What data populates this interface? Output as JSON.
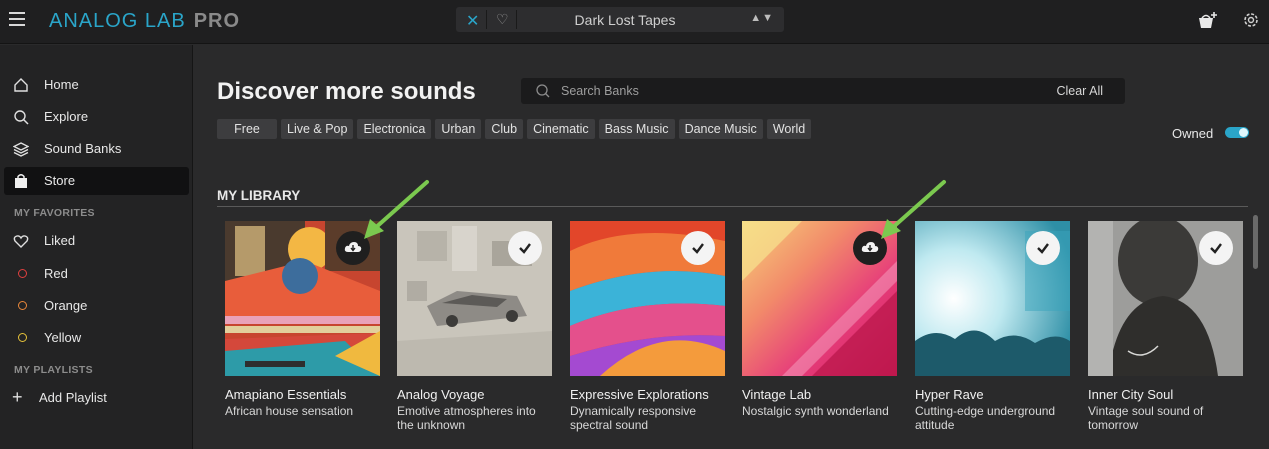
{
  "app": {
    "logo_main": "ANALOG LAB",
    "logo_edition": "PRO"
  },
  "preset_bar": {
    "preset_name": "Dark Lost Tapes",
    "nav_arrows": "▲▼"
  },
  "sidebar": {
    "nav": [
      {
        "label": "Home",
        "icon": "home-icon"
      },
      {
        "label": "Explore",
        "icon": "search-icon"
      },
      {
        "label": "Sound Banks",
        "icon": "layers-icon"
      },
      {
        "label": "Store",
        "icon": "shopping-bag-icon",
        "active": true
      }
    ],
    "favorites_header": "MY FAVORITES",
    "favorites": [
      {
        "label": "Liked",
        "icon": "heart-icon"
      },
      {
        "label": "Red",
        "color": "#e0403f"
      },
      {
        "label": "Orange",
        "color": "#e9873a"
      },
      {
        "label": "Yellow",
        "color": "#e6c23a"
      }
    ],
    "playlists_header": "MY PLAYLISTS",
    "add_playlist": "Add Playlist"
  },
  "main": {
    "title": "Discover more sounds",
    "search_placeholder": "Search Banks",
    "clear_all": "Clear All",
    "tags": [
      "Free",
      "Live & Pop",
      "Electronica",
      "Urban",
      "Club",
      "Cinematic",
      "Bass Music",
      "Dance Music",
      "World"
    ],
    "owned_label": "Owned",
    "owned_toggle_on": true,
    "library_header": "MY LIBRARY",
    "banks": [
      {
        "title": "Amapiano Essentials",
        "desc": "African house sensation",
        "status": "download"
      },
      {
        "title": "Analog Voyage",
        "desc": "Emotive atmospheres into the unknown",
        "status": "owned"
      },
      {
        "title": "Expressive Explorations",
        "desc": "Dynamically responsive spectral sound",
        "status": "owned"
      },
      {
        "title": "Vintage Lab",
        "desc": "Nostalgic synth wonderland",
        "status": "download"
      },
      {
        "title": "Hyper Rave",
        "desc": "Cutting-edge underground attitude",
        "status": "owned"
      },
      {
        "title": "Inner City Soul",
        "desc": "Vintage soul sound of tomorrow",
        "status": "owned"
      }
    ]
  },
  "colors": {
    "accent": "#2aa5c9",
    "annotation_arrow": "#7bc94f"
  }
}
